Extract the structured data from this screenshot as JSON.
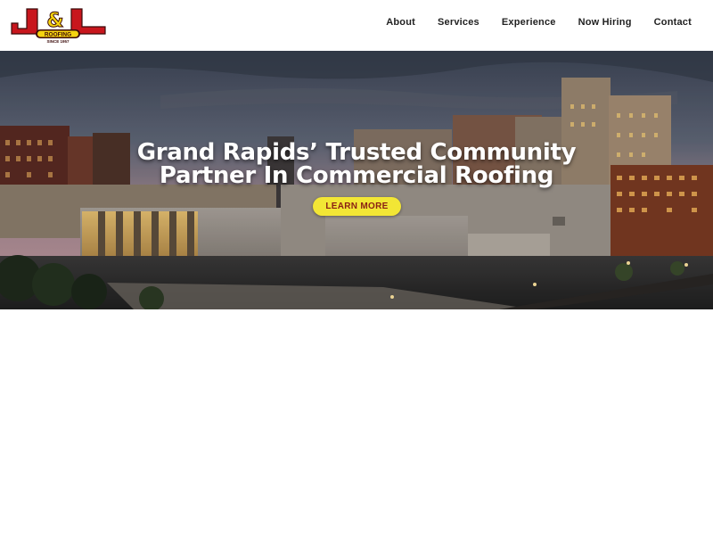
{
  "logo": {
    "brand": "J&L",
    "badge": "ROOFING",
    "since": "SINCE 1957",
    "colors": {
      "red": "#c8161d",
      "yellow": "#f5d30f",
      "dark": "#3a0a0a"
    }
  },
  "nav": {
    "items": [
      {
        "label": "About"
      },
      {
        "label": "Services"
      },
      {
        "label": "Experience"
      },
      {
        "label": "Now Hiring"
      },
      {
        "label": "Contact"
      }
    ]
  },
  "hero": {
    "title_line1": "Grand Rapids’ Trusted Community",
    "title_line2": "Partner In Commercial Roofing",
    "cta_label": "LEARN MORE",
    "image_subject": "downtown city skyline at dusk",
    "colors": {
      "cta_bg": "#f2e635",
      "cta_text": "#8a1f14",
      "sky_top": "#3d4556",
      "sky_horizon": "#c59aa0"
    }
  }
}
